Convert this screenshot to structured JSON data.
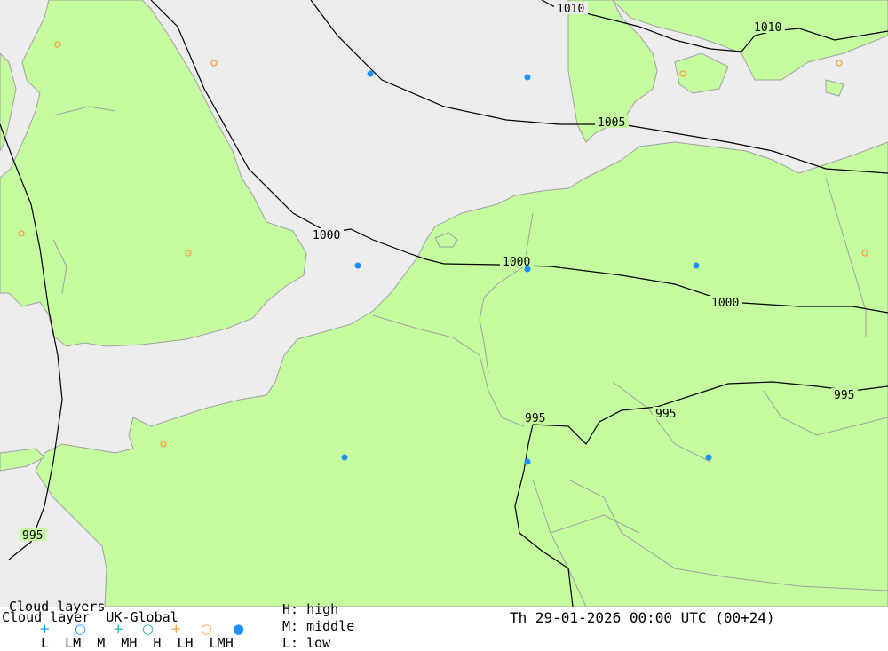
{
  "map": {
    "sea_color": "#ececec",
    "land_color": "#c5fb9f",
    "border_color": "#a0a0a0",
    "isobar_color": "#000000",
    "isobar_labels": [
      "1010",
      "1010",
      "1005",
      "1000",
      "1000",
      "1000",
      "995",
      "995",
      "995",
      "995"
    ],
    "symbol_colors": {
      "blue": "#1e90ff",
      "orange": "#f4a23c"
    }
  },
  "legend": {
    "title": "Cloud layers",
    "product": "Cloud layer  UK-Global",
    "symbols": [
      "+",
      "○",
      "+",
      "○",
      "+",
      "○",
      "●"
    ],
    "codes": "L  LM  M  MH  H  LH  LMH",
    "key_high": "H: high",
    "key_middle": "M: middle",
    "key_low": "L: low",
    "datetime": "Th 29-01-2026 00:00 UTC (00+24)"
  }
}
